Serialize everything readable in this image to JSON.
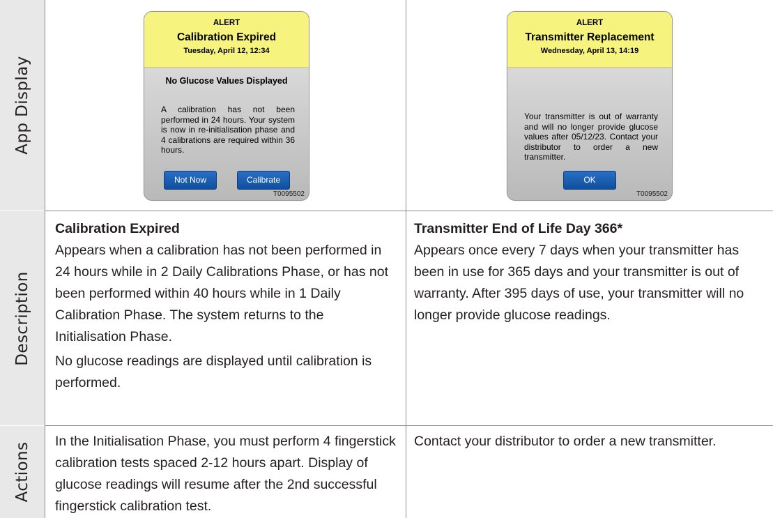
{
  "rows": {
    "app_display": "App Display",
    "description": "Description",
    "actions": "Actions"
  },
  "left": {
    "alert": {
      "kind": "ALERT",
      "title": "Calibration Expired",
      "date": "Tuesday, April 12, 12:34",
      "subheading": "No Glucose Values Displayed",
      "body": "A calibration has not been performed in 24 hours. Your system is now in re-initialisation phase and 4 calibrations are required within 36 hours.",
      "buttons": [
        "Not Now",
        "Calibrate"
      ],
      "code": "T0095502"
    },
    "description_title": "Calibration Expired",
    "description_body": "Appears when a calibration has not been performed in 24 hours while in 2 Daily Calibrations Phase, or has not been performed within 40 hours while in 1 Daily Calibration Phase. The system returns to the Initialisation Phase.",
    "description_note": "No glucose readings are displayed until calibration is performed.",
    "actions": "In the Initialisation Phase, you must perform 4 fingerstick calibration tests spaced 2-12 hours apart. Display of glucose readings will resume after the 2nd successful fingerstick calibration test."
  },
  "right": {
    "alert": {
      "kind": "ALERT",
      "title": "Transmitter Replacement",
      "date": "Wednesday, April 13, 14:19",
      "body": "Your transmitter is out of warranty and will no longer provide glucose values after 05/12/23. Contact your distributor to order a new transmitter.",
      "buttons": [
        "OK"
      ],
      "code": "T0095502"
    },
    "description_title": "Transmitter End of Life Day 366*",
    "description_body": "Appears once every 7 days when your transmitter has been in use for 365 days and your transmitter is out of warranty. After 395 days of use, your transmitter will no longer provide glucose readings.",
    "actions": "Contact your distributor to order a new transmitter."
  },
  "colors": {
    "alert_header": "#f6f37e",
    "button_blue": "#1a5fb4",
    "row_header_bg": "#e8e8e8"
  }
}
